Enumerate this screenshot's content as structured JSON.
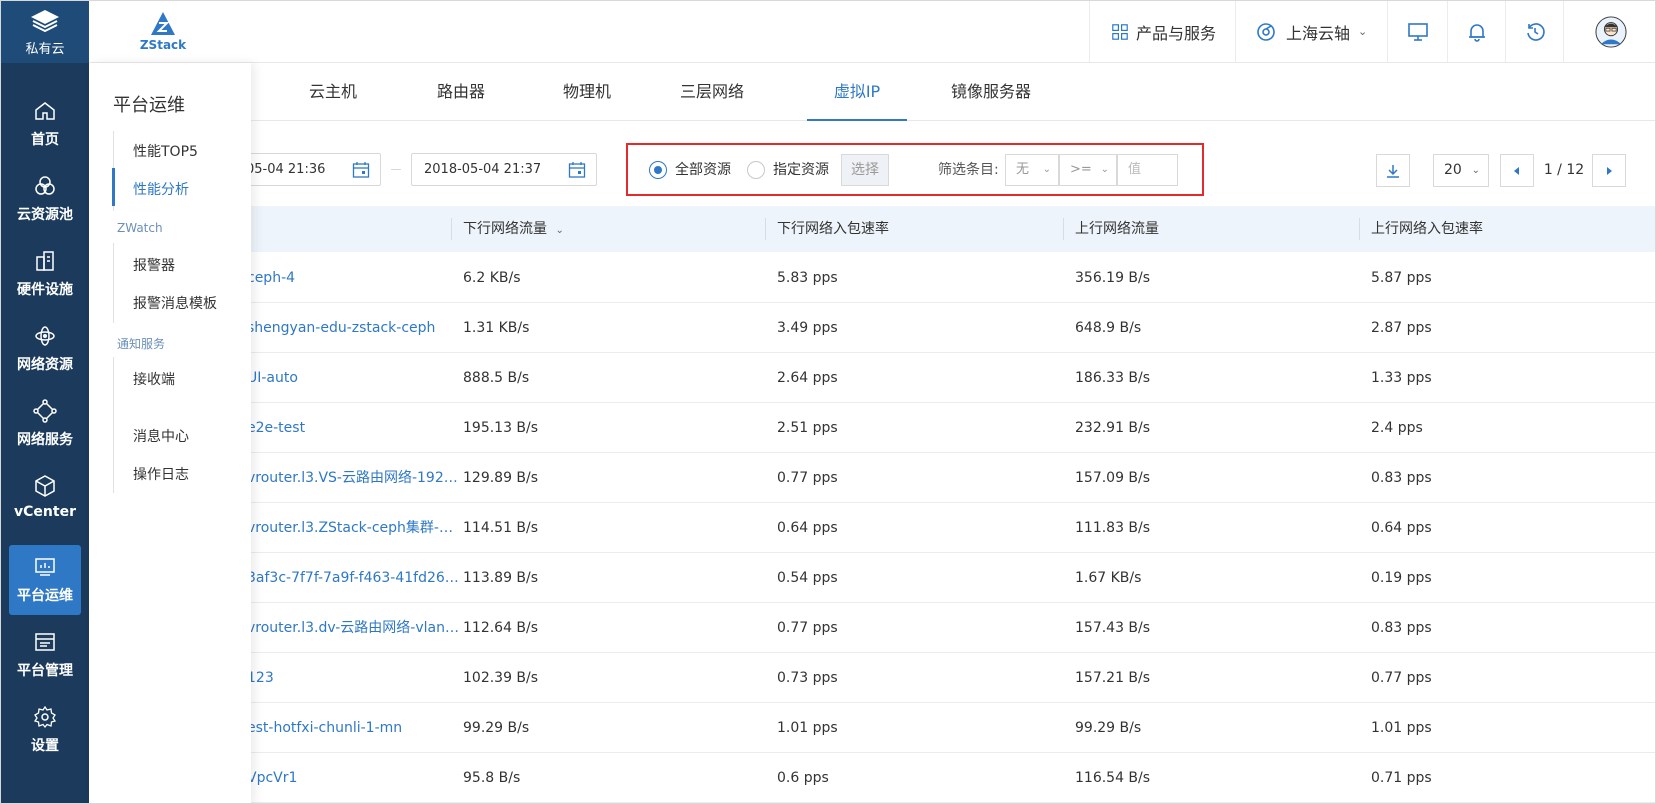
{
  "rail": {
    "brand": "私有云",
    "items": [
      {
        "label": "首页",
        "icon": "home-icon"
      },
      {
        "label": "云资源池",
        "icon": "cloud-pool-icon"
      },
      {
        "label": "硬件设施",
        "icon": "hardware-icon"
      },
      {
        "label": "网络资源",
        "icon": "network-resource-icon"
      },
      {
        "label": "网络服务",
        "icon": "network-service-icon"
      },
      {
        "label": "vCenter",
        "icon": "vcenter-icon"
      },
      {
        "label": "平台运维",
        "icon": "ops-icon",
        "active": true
      },
      {
        "label": "平台管理",
        "icon": "platform-manage-icon"
      },
      {
        "label": "设置",
        "icon": "settings-gear-icon"
      }
    ]
  },
  "logo": {
    "text": "ZStack"
  },
  "header": {
    "products": "产品与服务",
    "region": "上海云轴"
  },
  "submenu": {
    "title": "平台运维",
    "items": {
      "top5": "性能TOP5",
      "analysis": "性能分析",
      "zwatch_group": "ZWatch",
      "alarm": "报警器",
      "alarm_template": "报警消息模板",
      "notify_group": "通知服务",
      "receiver": "接收端",
      "message_center": "消息中心",
      "oplog": "操作日志"
    }
  },
  "tabs": [
    "云主机",
    "路由器",
    "物理机",
    "三层网络",
    "虚拟IP",
    "镜像服务器"
  ],
  "active_tab": "虚拟IP",
  "toolbar": {
    "start_date": "05-04 21:36",
    "end_date": "2018-05-04 21:37",
    "radio_all": "全部资源",
    "radio_specific": "指定资源",
    "select_button": "选择",
    "filter_label": "筛选条目:",
    "filter_field": "无",
    "filter_op": ">=",
    "filter_value_placeholder": "值",
    "page_size": "20",
    "pager": "1 / 12"
  },
  "table": {
    "columns": [
      "下行网络流量",
      "下行网络入包速率",
      "上行网络流量",
      "上行网络入包速率"
    ],
    "rows": [
      {
        "name": "ceph-4",
        "down_traffic": "6.2 KB/s",
        "down_pps": "5.83 pps",
        "up_traffic": "356.19 B/s",
        "up_pps": "5.87 pps"
      },
      {
        "name": "shengyan-edu-zstack-ceph",
        "down_traffic": "1.31 KB/s",
        "down_pps": "3.49 pps",
        "up_traffic": "648.9 B/s",
        "up_pps": "2.87 pps"
      },
      {
        "name": "UI-auto",
        "down_traffic": "888.5 B/s",
        "down_pps": "2.64 pps",
        "up_traffic": "186.33 B/s",
        "up_pps": "1.33 pps"
      },
      {
        "name": "e2e-test",
        "down_traffic": "195.13 B/s",
        "down_pps": "2.51 pps",
        "up_traffic": "232.91 B/s",
        "up_pps": "2.4 pps"
      },
      {
        "name": "vrouter.l3.VS-云路由网络-192…",
        "down_traffic": "129.89 B/s",
        "down_pps": "0.77 pps",
        "up_traffic": "157.09 B/s",
        "up_pps": "0.83 pps"
      },
      {
        "name": "vrouter.l3.ZStack-ceph集群-…",
        "down_traffic": "114.51 B/s",
        "down_pps": "0.64 pps",
        "up_traffic": "111.83 B/s",
        "up_pps": "0.64 pps"
      },
      {
        "name": "3af3c-7f7f-7a9f-f463-41fd26…",
        "down_traffic": "113.89 B/s",
        "down_pps": "0.54 pps",
        "up_traffic": "1.67 KB/s",
        "up_pps": "0.19 pps"
      },
      {
        "name": "vrouter.l3.dv-云路由网络-vlan…",
        "down_traffic": "112.64 B/s",
        "down_pps": "0.77 pps",
        "up_traffic": "157.43 B/s",
        "up_pps": "0.83 pps"
      },
      {
        "name": "123",
        "down_traffic": "102.39 B/s",
        "down_pps": "0.73 pps",
        "up_traffic": "157.21 B/s",
        "up_pps": "0.77 pps"
      },
      {
        "name": "est-hotfxi-chunli-1-mn",
        "down_traffic": "99.29 B/s",
        "down_pps": "1.01 pps",
        "up_traffic": "99.29 B/s",
        "up_pps": "1.01 pps"
      },
      {
        "name": "VpcVr1",
        "down_traffic": "95.8 B/s",
        "down_pps": "0.6 pps",
        "up_traffic": "116.54 B/s",
        "up_pps": "0.71 pps"
      }
    ]
  },
  "colors": {
    "rail": "#1b3a5c",
    "accent": "#2f78c6",
    "highlight_box": "#e32b2b",
    "table_header": "#eef4fb"
  }
}
